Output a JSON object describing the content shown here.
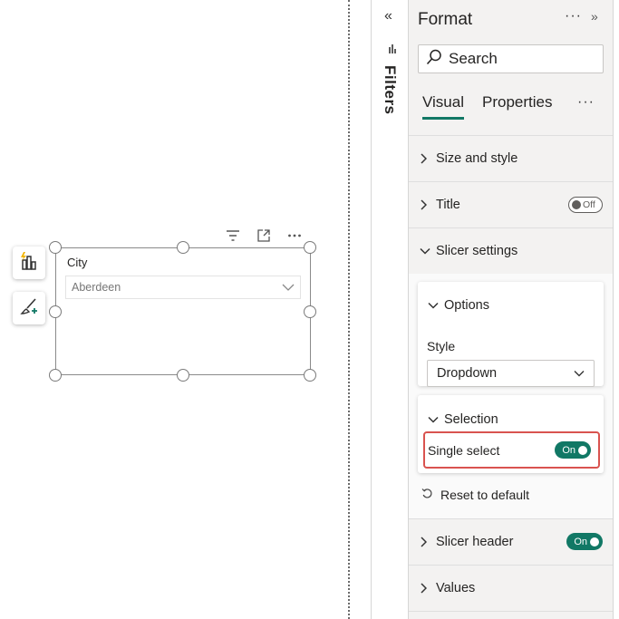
{
  "visual": {
    "slicer_title": "City",
    "slicer_value": "Aberdeen"
  },
  "filters": {
    "label": "Filters",
    "collapse_glyph": "«"
  },
  "format_pane": {
    "title": "Format",
    "more_glyph": "···",
    "expand_glyph": "»",
    "search_placeholder": "Search",
    "tabs": [
      {
        "label": "Visual",
        "active": true
      },
      {
        "label": "Properties",
        "active": false
      }
    ],
    "tabs_more": "···",
    "sections": {
      "size_and_style": "Size and style",
      "title": {
        "label": "Title",
        "toggle": "Off"
      },
      "slicer_settings": "Slicer settings",
      "options": {
        "label": "Options",
        "style_label": "Style",
        "style_value": "Dropdown"
      },
      "selection": {
        "label": "Selection",
        "single_select_label": "Single select",
        "single_select_toggle": "On"
      },
      "reset_label": "Reset to default",
      "slicer_header": {
        "label": "Slicer header",
        "toggle": "On"
      },
      "values": "Values"
    }
  },
  "colors": {
    "accent": "#117865",
    "highlight_border": "#d9534f",
    "pane_bg": "#f3f2f1"
  },
  "icons": [
    "build-visual-icon",
    "format-visual-icon",
    "filter-icon",
    "focus-mode-icon",
    "more-options-icon",
    "search-icon",
    "chevron-right-icon",
    "chevron-down-icon",
    "reset-icon",
    "filters-pane-icon"
  ]
}
